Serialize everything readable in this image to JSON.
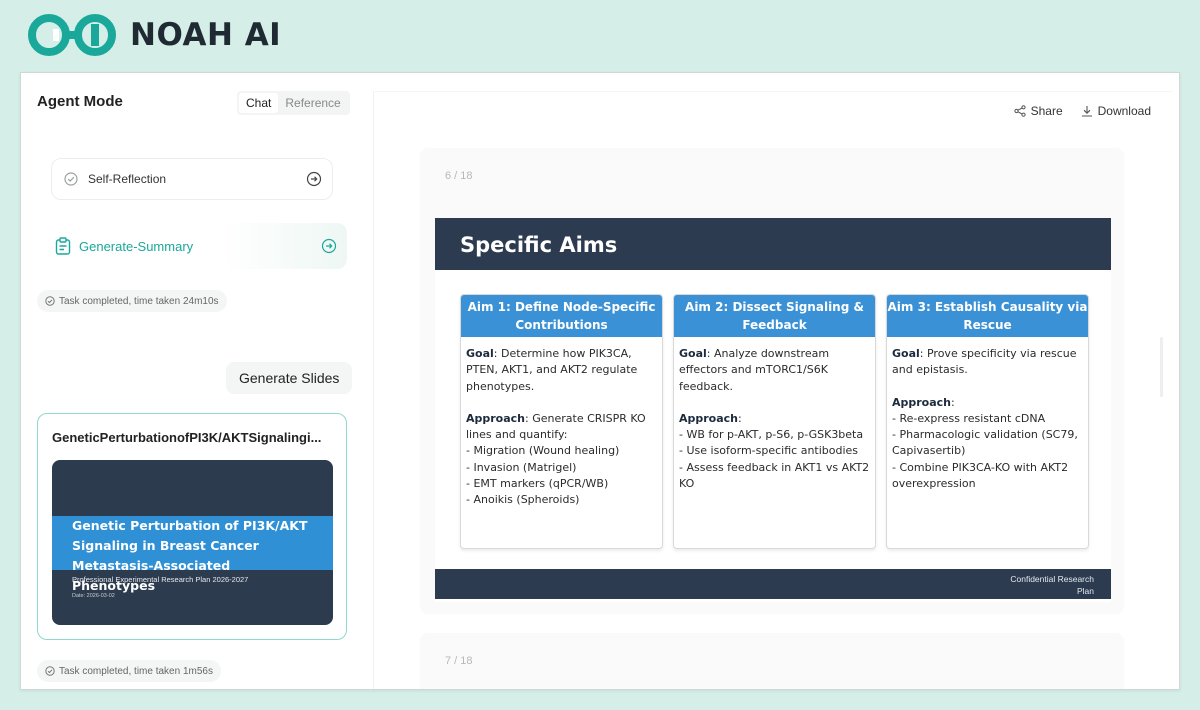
{
  "brand": {
    "name": "NOAH AI",
    "color": "#1aa89a"
  },
  "left": {
    "title": "Agent Mode",
    "tabs": [
      {
        "label": "Chat",
        "active": true
      },
      {
        "label": "Reference",
        "active": false
      }
    ],
    "self_reflection": {
      "label": "Self-Reflection",
      "icon": "check-circle-icon"
    },
    "generate_summary": {
      "label": "Generate-Summary",
      "icon": "clipboard-icon"
    },
    "task1": "Task completed, time taken 24m10s",
    "generate_slides": "Generate Slides",
    "preview": {
      "title": "GeneticPerturbationofPI3K/AKTSignalingi...",
      "thumb_title": "Genetic Perturbation of PI3K/AKT Signaling in Breast Cancer Metastasis-Associated Phenotypes",
      "thumb_subtitle": "Professional Experimental Research Plan 2026-2027",
      "thumb_date": "Date: 2026-03-02"
    },
    "task2": "Task completed, time taken 1m56s"
  },
  "right": {
    "share": "Share",
    "download": "Download",
    "slide1_number": "6 / 18",
    "slide2_number": "7 / 18",
    "slide": {
      "title": "Specific Aims",
      "footer": "Confidential Research Plan",
      "aims": [
        {
          "title": "Aim 1: Define Node-Specific Contributions",
          "goal_label": "Goal",
          "goal": ": Determine how PIK3CA, PTEN, AKT1, and AKT2 regulate phenotypes.",
          "approach_label": "Approach",
          "approach": ": Generate CRISPR KO lines and quantify:",
          "items": [
            "- Migration (Wound healing)",
            "- Invasion (Matrigel)",
            "- EMT markers (qPCR/WB)",
            "- Anoikis (Spheroids)"
          ]
        },
        {
          "title": "Aim 2: Dissect Signaling & Feedback",
          "goal_label": "Goal",
          "goal": ": Analyze downstream effectors and mTORC1/S6K feedback.",
          "approach_label": "Approach",
          "approach": ":",
          "items": [
            "- WB for p-AKT, p-S6, p-GSK3beta",
            "- Use isoform-specific antibodies",
            "- Assess feedback in AKT1 vs AKT2 KO"
          ]
        },
        {
          "title": "Aim 3: Establish Causality via Rescue",
          "goal_label": "Goal",
          "goal": ": Prove specificity via rescue and epistasis.",
          "approach_label": "Approach",
          "approach": ":",
          "items": [
            "- Re-express resistant cDNA",
            "- Pharmacologic validation (SC79, Capivasertib)",
            "- Combine PIK3CA-KO with AKT2 overexpression"
          ]
        }
      ]
    }
  }
}
